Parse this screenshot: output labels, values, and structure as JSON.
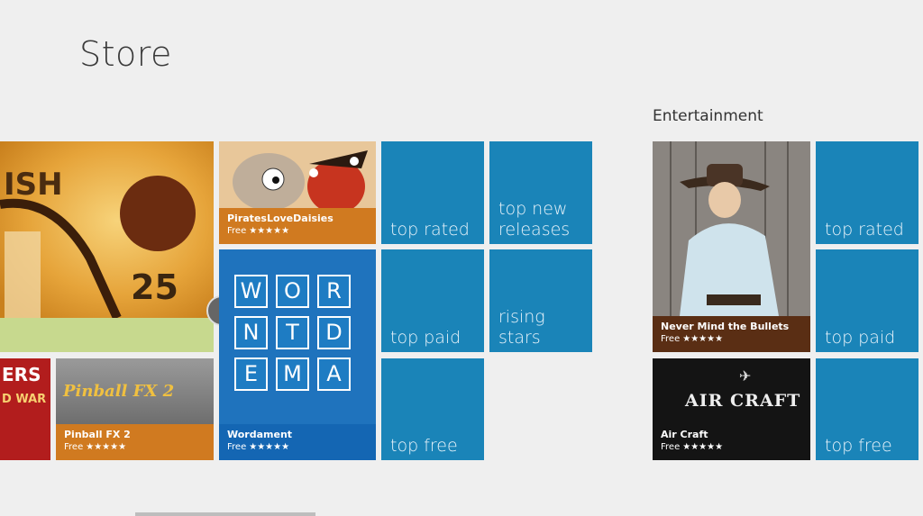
{
  "header": {
    "title": "Store"
  },
  "group2": {
    "title": "Entertainment"
  },
  "featured": {
    "text_top": "ISH",
    "text_number": "25"
  },
  "partial_left": {
    "text1": "ERS",
    "text2": "D WAR"
  },
  "apps": {
    "pirates": {
      "name": "PiratesLoveDaisies",
      "price": "Free",
      "stars": "★★★★★"
    },
    "pinball": {
      "name": "Pinball FX 2",
      "price": "Free",
      "stars": "★★★★★",
      "logo": "Pinball FX 2"
    },
    "wordament": {
      "name": "Wordament",
      "price": "Free",
      "stars": "★★★★★",
      "letters": [
        "W",
        "O",
        "R",
        "N",
        "T",
        "D",
        "E",
        "M",
        "A"
      ]
    },
    "bullets": {
      "name": "Never Mind the Bullets",
      "price": "Free",
      "stars": "★★★★★"
    },
    "aircraft": {
      "name": "Air Craft",
      "price": "Free",
      "stars": "★★★★★",
      "logo": "AIR CRAFT"
    }
  },
  "tiles": {
    "top_rated": "top rated",
    "top_new_releases": "top new releases",
    "top_paid": "top paid",
    "rising_stars": "rising stars",
    "top_free": "top free",
    "ent_top_rated": "top rated",
    "ent_top_paid": "top paid",
    "ent_top_free": "top free"
  },
  "colors": {
    "tile_blue": "#1a84b8",
    "orange": "#d0711b",
    "wordament_blue": "#1466b3"
  }
}
